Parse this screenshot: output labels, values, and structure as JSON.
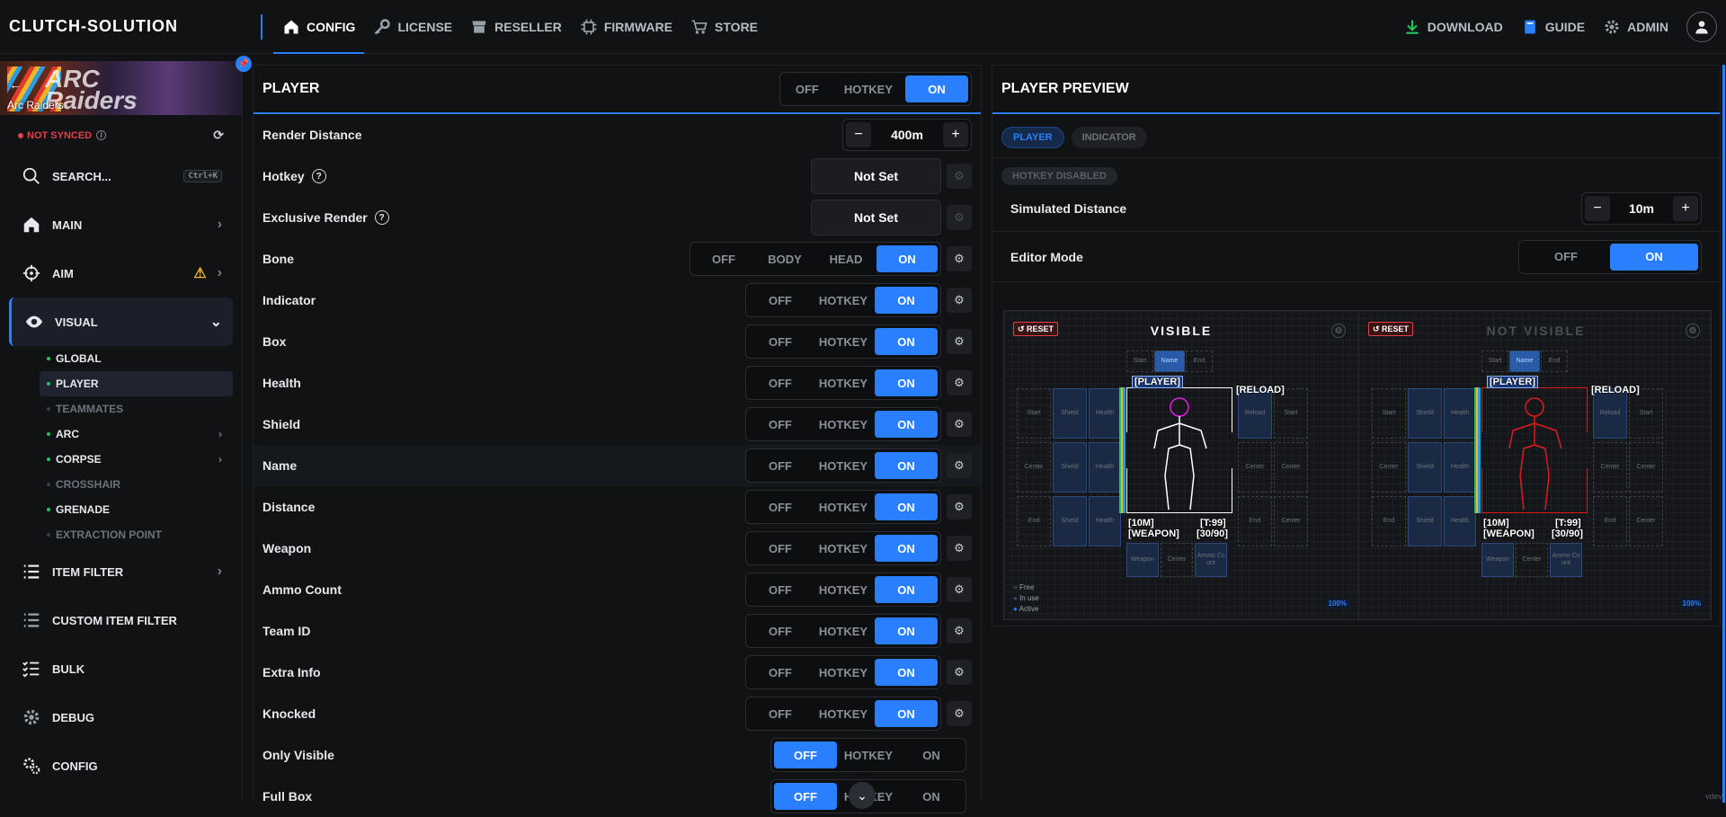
{
  "brand": "CLUTCH-SOLUTION",
  "nav": {
    "config": "CONFIG",
    "license": "LICENSE",
    "reseller": "RESELLER",
    "firmware": "FIRMWARE",
    "store": "STORE"
  },
  "nav_right": {
    "download": "DOWNLOAD",
    "guide": "GUIDE",
    "admin": "ADMIN"
  },
  "game": {
    "name": "Arc Raiders",
    "logo_line1": "ARC",
    "logo_line2": "Raiders"
  },
  "sync": {
    "status": "NOT SYNCED",
    "info": "i"
  },
  "sidebar": {
    "search": "SEARCH...",
    "search_kbd": "Ctrl+K",
    "main": "MAIN",
    "aim": "AIM",
    "visual": "VISUAL",
    "sub": [
      "GLOBAL",
      "PLAYER",
      "TEAMMATES",
      "ARC",
      "CORPSE",
      "CROSSHAIR",
      "GRENADE",
      "EXTRACTION POINT"
    ],
    "item_filter": "ITEM FILTER",
    "custom_item_filter": "CUSTOM ITEM FILTER",
    "bulk": "BULK",
    "debug": "DEBUG",
    "config": "CONFIG"
  },
  "player": {
    "title": "PLAYER",
    "mode": {
      "off": "OFF",
      "hotkey": "HOTKEY",
      "on": "ON"
    },
    "render_distance": {
      "label": "Render Distance",
      "value": "400m",
      "minus": "−",
      "plus": "+"
    },
    "hotkey": {
      "label": "Hotkey",
      "value": "Not Set",
      "help": "?"
    },
    "exclusive_render": {
      "label": "Exclusive Render",
      "value": "Not Set",
      "help": "?"
    },
    "bone": {
      "label": "Bone",
      "opts": [
        "OFF",
        "BODY",
        "HEAD",
        "ON"
      ]
    },
    "toggles": [
      {
        "label": "Indicator",
        "off": "OFF",
        "hotkey": "HOTKEY",
        "on": "ON"
      },
      {
        "label": "Box",
        "off": "OFF",
        "hotkey": "HOTKEY",
        "on": "ON"
      },
      {
        "label": "Health",
        "off": "OFF",
        "hotkey": "HOTKEY",
        "on": "ON"
      },
      {
        "label": "Shield",
        "off": "OFF",
        "hotkey": "HOTKEY",
        "on": "ON"
      },
      {
        "label": "Name",
        "off": "OFF",
        "hotkey": "HOTKEY",
        "on": "ON"
      },
      {
        "label": "Distance",
        "off": "OFF",
        "hotkey": "HOTKEY",
        "on": "ON"
      },
      {
        "label": "Weapon",
        "off": "OFF",
        "hotkey": "HOTKEY",
        "on": "ON"
      },
      {
        "label": "Ammo Count",
        "off": "OFF",
        "hotkey": "HOTKEY",
        "on": "ON"
      },
      {
        "label": "Team ID",
        "off": "OFF",
        "hotkey": "HOTKEY",
        "on": "ON"
      },
      {
        "label": "Extra Info",
        "off": "OFF",
        "hotkey": "HOTKEY",
        "on": "ON"
      },
      {
        "label": "Knocked",
        "off": "OFF",
        "hotkey": "HOTKEY",
        "on": "ON"
      }
    ],
    "only_visible": {
      "label": "Only Visible",
      "off": "OFF",
      "hotkey": "HOTKEY",
      "on": "ON"
    },
    "full_box": {
      "label": "Full Box",
      "off": "OFF",
      "hotkey": "HOTKEY",
      "on": "ON"
    }
  },
  "preview": {
    "title": "PLAYER PREVIEW",
    "tab_player": "PLAYER",
    "tab_indicator": "INDICATOR",
    "hotkey_disabled": "HOTKEY DISABLED",
    "simulated_distance": {
      "label": "Simulated Distance",
      "value": "10m",
      "minus": "−",
      "plus": "+"
    },
    "editor_mode": {
      "label": "Editor Mode",
      "off": "OFF",
      "on": "ON"
    },
    "reset": "↺ RESET",
    "visible": "VISIBLE",
    "not_visible": "NOT VISIBLE",
    "slots": {
      "start": "Start",
      "name": "Name",
      "end": "End",
      "shield": "Shield",
      "health": "Health",
      "reload": "Reload",
      "center": "Center",
      "weapon": "Weapon",
      "ammo": "Ammo Co unt"
    },
    "tags": {
      "player": "[PLAYER]",
      "reload": "[RELOAD]",
      "dist": "[10M]",
      "team": "[T:99]",
      "weapon": "[WEAPON]",
      "ammo": "[30/90]"
    },
    "legend": [
      "Free",
      "In use",
      "Active"
    ],
    "zoom": "100%",
    "colors": {
      "visible_box": "#ffffff",
      "hidden_box": "#e01b1b",
      "head_visible": "#e020e0"
    }
  },
  "watermark": "vdev"
}
